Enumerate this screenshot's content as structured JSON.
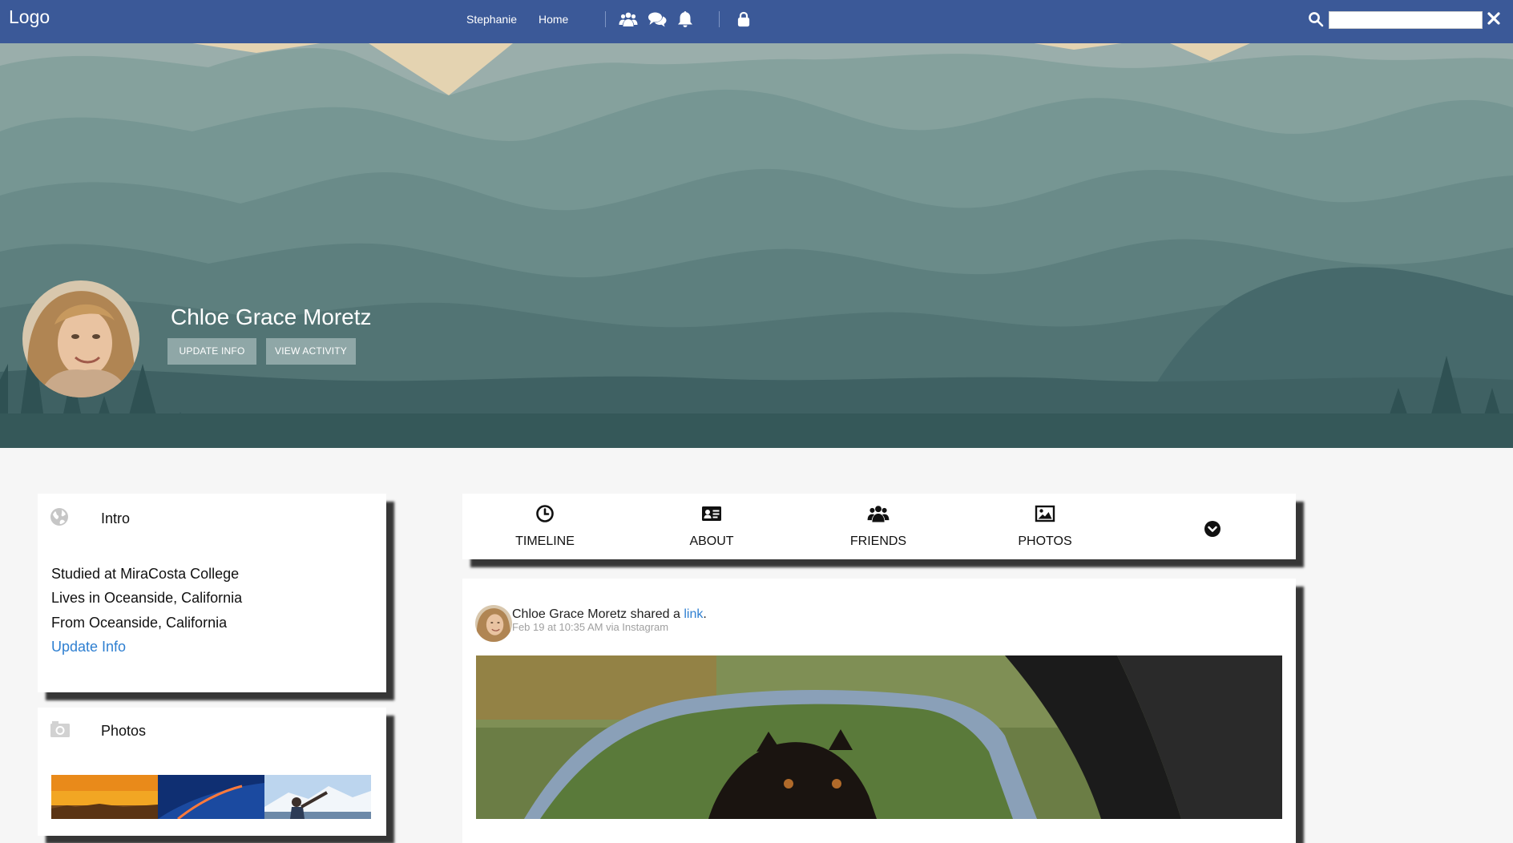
{
  "topbar": {
    "logo": "Logo",
    "nav": [
      {
        "label": "Stephanie"
      },
      {
        "label": "Home"
      }
    ],
    "icons": [
      "users-icon",
      "chat-icon",
      "bell-icon",
      "lock-icon"
    ],
    "search": {
      "value": "",
      "placeholder": ""
    },
    "color": "#3b5998"
  },
  "profile": {
    "name": "Chloe Grace Moretz",
    "buttons": {
      "update_info": "UPDATE INFO",
      "view_activity": "VIEW ACTIVITY"
    }
  },
  "intro": {
    "title": "Intro",
    "lines": [
      "Studied at MiraCosta College",
      "Lives in Oceanside, California",
      "From Oceanside, California"
    ],
    "update_link": "Update Info"
  },
  "photos": {
    "title": "Photos"
  },
  "tabs": [
    {
      "label": "TIMELINE",
      "icon": "clock-icon"
    },
    {
      "label": "ABOUT",
      "icon": "id-card-icon"
    },
    {
      "label": "FRIENDS",
      "icon": "users-icon"
    },
    {
      "label": "PHOTOS",
      "icon": "image-icon"
    }
  ],
  "more_tab_icon": "chevron-down-circle-icon",
  "post": {
    "author": "Chloe Grace Moretz",
    "action": " shared a ",
    "link_text": "link",
    "period": ".",
    "meta": "Feb 19 at 10:35 AM via Instagram"
  },
  "colors": {
    "link": "#2e7fd1",
    "cover_button": "#8fa7a7"
  }
}
